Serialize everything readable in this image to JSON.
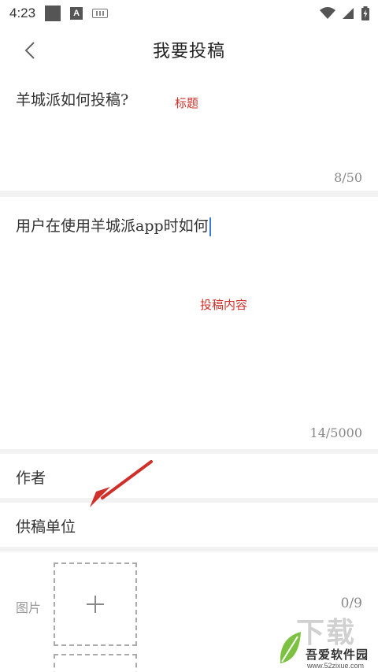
{
  "status_bar": {
    "time": "4:23",
    "icons": [
      "square-notification-icon",
      "a-notification-icon",
      "keyboard-icon",
      "wifi-icon",
      "signal-icon",
      "battery-icon"
    ]
  },
  "header": {
    "title": "我要投稿",
    "back_icon": "chevron-left-icon"
  },
  "title_field": {
    "value": "羊城派如何投稿?",
    "counter": "8/50",
    "annotation": "标题"
  },
  "content_field": {
    "value": "用户在使用羊城派app时如何",
    "counter": "14/5000",
    "annotation": "投稿内容",
    "caret_color": "#3a7bd5"
  },
  "author_field": {
    "placeholder": "作者"
  },
  "unit_field": {
    "placeholder": "供稿单位"
  },
  "image_field": {
    "label": "图片",
    "counter": "0/9",
    "add_icon": "plus-icon"
  },
  "watermark": {
    "text": "吾爱软件园",
    "url": "www.52zixue.com",
    "big_text": "下载"
  },
  "colors": {
    "annotation": "#d0302a",
    "background": "#f2f2f2",
    "surface": "#ffffff"
  }
}
